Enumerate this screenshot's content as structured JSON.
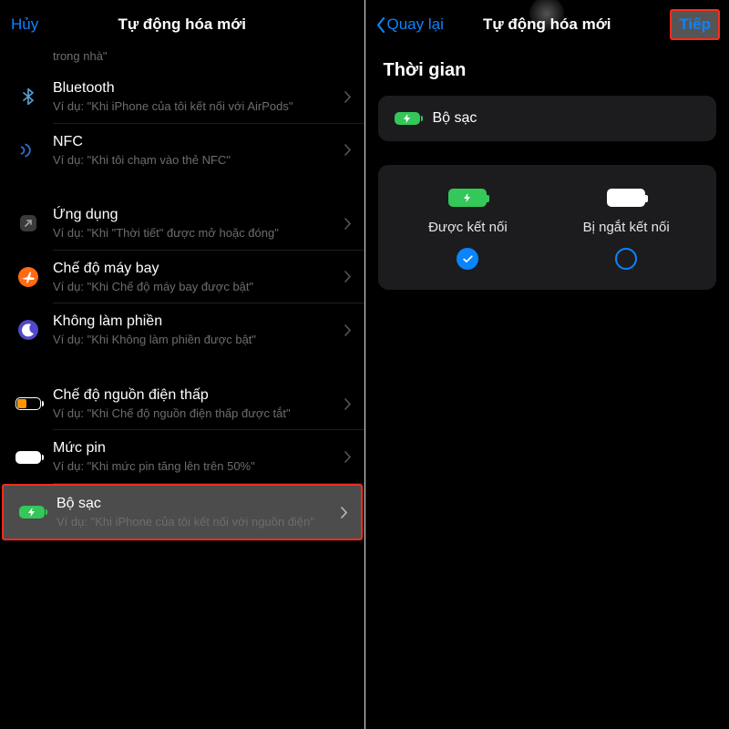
{
  "left": {
    "cancel": "Hủy",
    "title": "Tự động hóa mới",
    "home_frag": "trong nhà\"",
    "rows": [
      {
        "icon": "bluetooth",
        "title": "Bluetooth",
        "sub": "Ví dụ: \"Khi iPhone của tôi kết nối với AirPods\""
      },
      {
        "icon": "nfc",
        "title": "NFC",
        "sub": "Ví dụ: \"Khi tôi chạm vào thẻ NFC\""
      }
    ],
    "rows2": [
      {
        "icon": "app",
        "title": "Ứng dụng",
        "sub": "Ví dụ: \"Khi \"Thời tiết\" được mở hoặc đóng\""
      },
      {
        "icon": "airplane",
        "title": "Chế độ máy bay",
        "sub": "Ví dụ: \"Khi Chế độ máy bay được bật\""
      },
      {
        "icon": "dnd",
        "title": "Không làm phiền",
        "sub": "Ví dụ: \"Khi Không làm phiền được bật\""
      }
    ],
    "rows3": [
      {
        "icon": "lowpower",
        "title": "Chế độ nguồn điện thấp",
        "sub": "Ví dụ: \"Khi Chế độ nguồn điện thấp được tắt\""
      },
      {
        "icon": "battlevel",
        "title": "Mức pin",
        "sub": "Ví dụ: \"Khi mức pin tăng lên trên 50%\""
      },
      {
        "icon": "charger",
        "title": "Bộ sạc",
        "sub": "Ví dụ: \"Khi iPhone của tôi kết nối với nguồn điện\""
      }
    ]
  },
  "right": {
    "back": "Quay lại",
    "title": "Tự động hóa mới",
    "next": "Tiếp",
    "section": "Thời gian",
    "card_label": "Bộ sạc",
    "choice_connected": "Được kết nối",
    "choice_disconnected": "Bị ngắt kết nối"
  }
}
